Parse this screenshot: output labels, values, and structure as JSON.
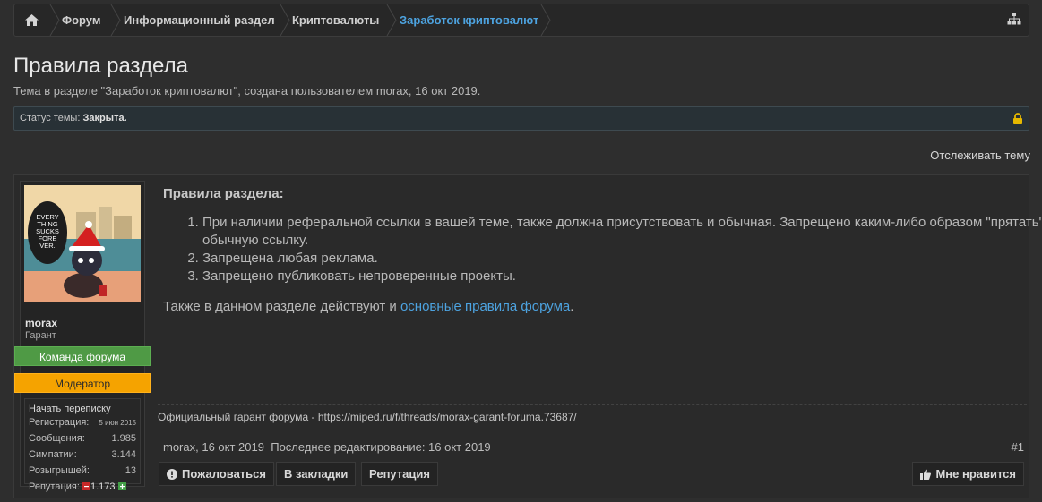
{
  "breadcrumb": {
    "items": [
      {
        "label": "Форум"
      },
      {
        "label": "Информационный раздел"
      },
      {
        "label": "Криптовалюты"
      },
      {
        "label": "Заработок криптовалют"
      }
    ],
    "active_color": "#4da3e0"
  },
  "thread": {
    "title": "Правила раздела",
    "subtitle": "Тема в разделе \"Заработок криптовалют\", создана пользователем morax, 16 окт 2019.",
    "status_label": "Статус темы:",
    "status_value": "Закрыта.",
    "watch_label": "Отслеживать тему"
  },
  "author": {
    "name": "morax",
    "title": "Гарант",
    "ribbons": [
      "Команда форума",
      "Модератор"
    ],
    "avatar_text": "EVERY THING SUCKS FORE VER.",
    "start_convo": "Начать переписку",
    "stats": [
      {
        "label": "Регистрация:",
        "value": "5 июн 2015"
      },
      {
        "label": "Сообщения:",
        "value": "1.985"
      },
      {
        "label": "Симпатии:",
        "value": "3.144"
      },
      {
        "label": "Розыгрышей:",
        "value": "13"
      },
      {
        "label": "Репутация:",
        "value": "1.173"
      }
    ]
  },
  "post": {
    "heading": "Правила раздела:",
    "rules": [
      "При наличии реферальной ссылки в вашей теме, также должна присутствовать и обычная. Запрещено каким-либо образом \"прятать\" обычную ссылку.",
      "Запрещена любая реклама.",
      "Запрещено публиковать непроверенные проекты."
    ],
    "also_text": "Также в данном разделе действуют и ",
    "also_link": "основные правила форума",
    "also_end": ".",
    "signature": "Официальный гарант форума - https://miped.ru/f/threads/morax-garant-foruma.73687/",
    "author": "morax",
    "date": "16 окт 2019",
    "edited": "Последнее редактирование: 16 окт 2019",
    "number": "#1"
  },
  "actions": {
    "report": "Пожаловаться",
    "bookmark": "В закладки",
    "reputation": "Репутация",
    "like": "Мне нравится"
  }
}
